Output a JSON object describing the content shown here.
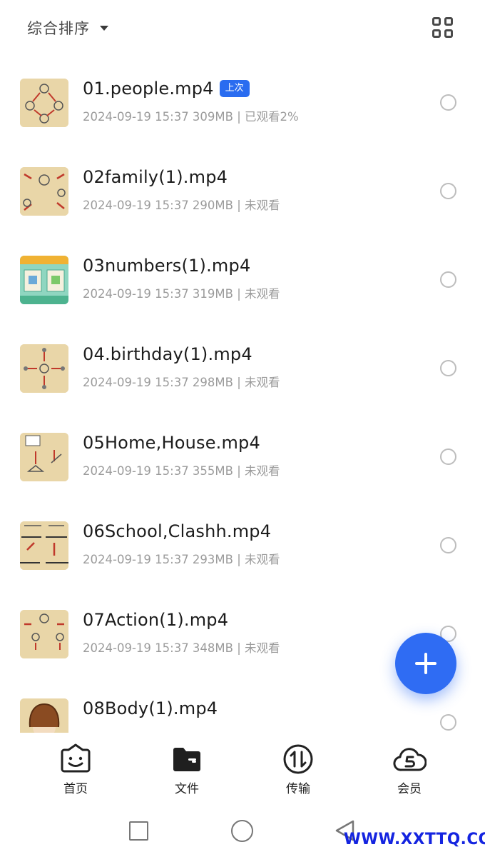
{
  "header": {
    "sort_label": "综合排序",
    "sort_icon": "caret-down-icon",
    "view_toggle_icon": "grid-view-icon"
  },
  "files": [
    {
      "name": "01.people.mp4",
      "badge": "上次",
      "meta": "2024-09-19 15:37  309MB | 已观看2%"
    },
    {
      "name": "02family(1).mp4",
      "meta": "2024-09-19 15:37  290MB | 未观看"
    },
    {
      "name": "03numbers(1).mp4",
      "meta": "2024-09-19 15:37  319MB | 未观看"
    },
    {
      "name": "04.birthday(1).mp4",
      "meta": "2024-09-19 15:37  298MB | 未观看"
    },
    {
      "name": "05Home,House.mp4",
      "meta": "2024-09-19 15:37  355MB | 未观看"
    },
    {
      "name": "06School,Clashh.mp4",
      "meta": "2024-09-19 15:37  293MB | 未观看"
    },
    {
      "name": "07Action(1).mp4",
      "meta": "2024-09-19 15:37  348MB | 未观看"
    },
    {
      "name": "08Body(1).mp4",
      "meta": ""
    }
  ],
  "fab": {
    "icon": "plus-icon"
  },
  "tabs": [
    {
      "label": "首页",
      "icon": "smiley-home-icon"
    },
    {
      "label": "文件",
      "icon": "folder-icon"
    },
    {
      "label": "传输",
      "icon": "transfer-icon"
    },
    {
      "label": "会员",
      "icon": "vip-cloud-icon"
    }
  ],
  "watermark": "WWW.XXTTQ.COM",
  "colors": {
    "accent": "#2f6cf3",
    "badge": "#2a6cf0",
    "meta_text": "#9b9b9b",
    "watermark": "#1424e0"
  }
}
